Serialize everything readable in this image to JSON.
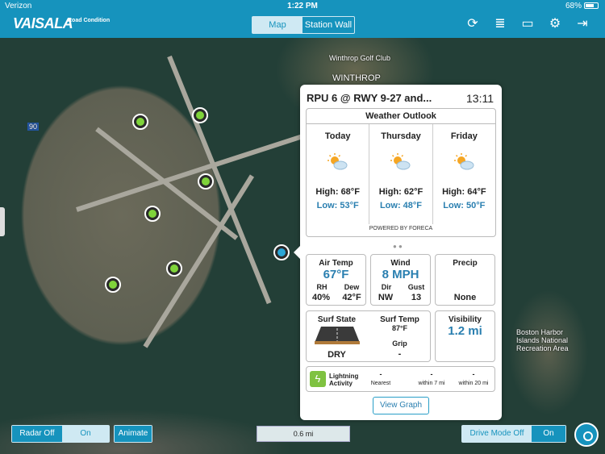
{
  "status_bar": {
    "carrier": "Verizon",
    "time": "1:22 PM",
    "battery": "68%"
  },
  "header": {
    "logo": "VAISALA",
    "logo_sub": "Road Condition",
    "tabs": [
      "Map",
      "Station Wall"
    ],
    "active_tab": "Map"
  },
  "map_labels": [
    "Winthrop Golf Club",
    "WINTHROP",
    "Boston Harbor Islands National Recreation Area",
    "90"
  ],
  "popup": {
    "title": "RPU 6 @ RWY 9-27 and...",
    "time": "13:11",
    "outlook": {
      "heading": "Weather Outlook",
      "days": [
        {
          "name": "Today",
          "high": "High: 68°F",
          "low": "Low: 53°F"
        },
        {
          "name": "Thursday",
          "high": "High: 62°F",
          "low": "Low: 48°F"
        },
        {
          "name": "Friday",
          "high": "High: 64°F",
          "low": "Low: 50°F"
        }
      ],
      "powered_by": "POWERED BY FORECA"
    },
    "air_temp": {
      "label": "Air Temp",
      "value": "67°F",
      "rh_label": "RH",
      "rh": "40%",
      "dew_label": "Dew",
      "dew": "42°F"
    },
    "wind": {
      "label": "Wind",
      "value": "8 MPH",
      "dir_label": "Dir",
      "dir": "NW",
      "gust_label": "Gust",
      "gust": "13"
    },
    "precip": {
      "label": "Precip",
      "value": "None"
    },
    "surf_state": {
      "label": "Surf State",
      "value": "DRY"
    },
    "surf_temp": {
      "label": "Surf Temp",
      "value": "87°F",
      "grip_label": "Grip",
      "grip": "-"
    },
    "visibility": {
      "label": "Visibility",
      "value": "1.2 mi"
    },
    "lightning": {
      "label": "Lightning Activity",
      "nearest_value": "-",
      "nearest_label": "Nearest",
      "within7_value": "-",
      "within7_label": "within 7 mi",
      "within20_value": "-",
      "within20_label": "within 20 mi"
    },
    "graph_button": "View Graph"
  },
  "controls": {
    "radar": {
      "label": "Radar Off",
      "on": "On"
    },
    "animate": "Animate",
    "scale": "0.6 mi",
    "drive_mode": {
      "label": "Drive Mode Off",
      "on": "On"
    }
  },
  "colors": {
    "accent": "#1693bd",
    "marker_green": "#7fd33a",
    "value_blue": "#2a7fb0"
  }
}
